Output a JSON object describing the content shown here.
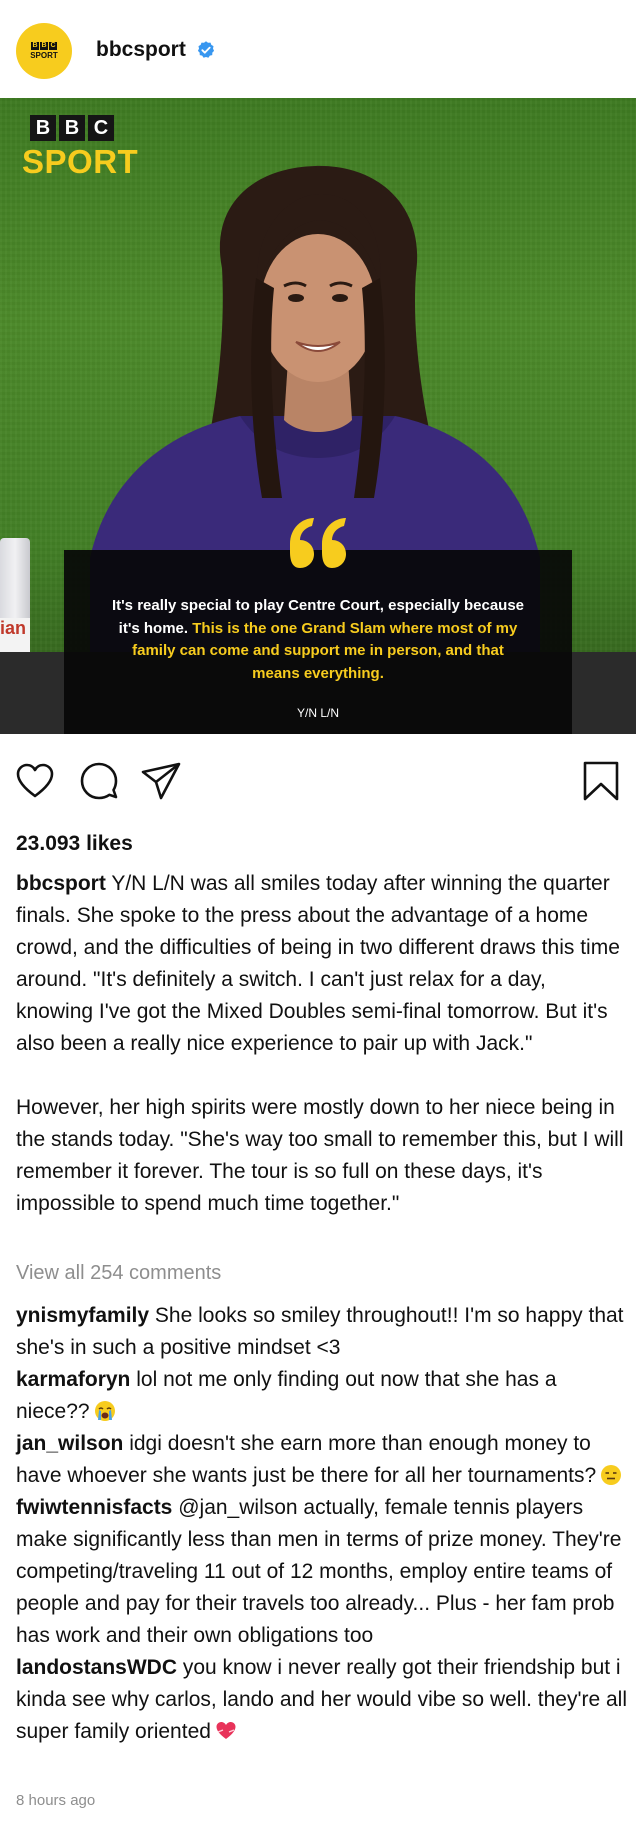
{
  "post": {
    "username": "bbcsport",
    "avatar": {
      "logo_letters": [
        "B",
        "B",
        "C"
      ],
      "logo_sport": "SPORT"
    },
    "image": {
      "brand_letters": [
        "B",
        "B",
        "C"
      ],
      "brand_sport": "SPORT",
      "quote_plain": "It's really special to play Centre Court, especially because it's home. ",
      "quote_highlight": "This is the one Grand Slam where most of my family can come and support me in person, and that means everything.",
      "attribution": "Y/N L/N",
      "bottle_label": "ian"
    },
    "likes": "23.093 likes",
    "caption": {
      "username": "bbcsport",
      "paragraph1": "Y/N L/N was all smiles today after winning the quarter finals. She spoke to the press about the advantage of a home crowd, and the difficulties of being in two different draws this time around. \"It's definitely a switch. I can't just relax for a day, knowing I've got the Mixed Doubles semi-final tomorrow. But it's also been a really nice experience to pair up with Jack.\"",
      "paragraph2": "However, her high spirits were mostly down to her niece being in the stands today. \"She's way too small to remember this, but I will remember it forever. The tour is so full on these days, it's impossible to spend much time together.\""
    },
    "view_all_comments": "View all 254 comments",
    "comments": [
      {
        "user": "ynismyfamily",
        "text": "She looks so smiley throughout!! I'm so happy that she's in such a positive mindset <3",
        "emoji": ""
      },
      {
        "user": "karmaforyn",
        "text": "lol not me only finding out now that she has a niece??",
        "emoji": "crying-face-emoji"
      },
      {
        "user": "jan_wilson",
        "text": "idgi doesn't she earn more than enough money to have whoever she wants just be there for all her tournaments?",
        "emoji": "expressionless-face-emoji"
      },
      {
        "user": "fwiwtennisfacts",
        "text": "@jan_wilson actually, female tennis players make significantly less than men in terms of prize money. They're competing/traveling 11 out of 12 months, employ entire teams of people and pay for their travels too already... Plus - her fam prob has work and their own obligations too",
        "emoji": ""
      },
      {
        "user": "landostansWDC",
        "text": "you know i never really got their friendship but i kinda see why carlos, lando and her would vibe so well. they're all super family oriented",
        "emoji": "heart-emoji"
      }
    ],
    "timestamp": "8 hours ago"
  },
  "icons": {
    "verified": "verified-badge-icon",
    "like": "heart-icon",
    "comment": "comment-icon",
    "share": "send-icon",
    "save": "bookmark-icon"
  },
  "colors": {
    "brand_yellow": "#f7cc1e",
    "verified_blue": "#3897f0",
    "muted_text": "#8e8e8e",
    "jumper_purple": "#3a2a7a"
  }
}
